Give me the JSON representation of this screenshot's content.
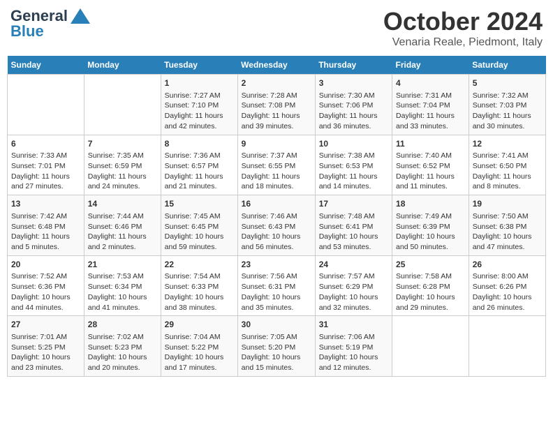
{
  "logo": {
    "line1": "General",
    "line2": "Blue"
  },
  "title": "October 2024",
  "subtitle": "Venaria Reale, Piedmont, Italy",
  "days_of_week": [
    "Sunday",
    "Monday",
    "Tuesday",
    "Wednesday",
    "Thursday",
    "Friday",
    "Saturday"
  ],
  "weeks": [
    [
      {
        "day": "",
        "data": ""
      },
      {
        "day": "",
        "data": ""
      },
      {
        "day": "1",
        "data": "Sunrise: 7:27 AM\nSunset: 7:10 PM\nDaylight: 11 hours and 42 minutes."
      },
      {
        "day": "2",
        "data": "Sunrise: 7:28 AM\nSunset: 7:08 PM\nDaylight: 11 hours and 39 minutes."
      },
      {
        "day": "3",
        "data": "Sunrise: 7:30 AM\nSunset: 7:06 PM\nDaylight: 11 hours and 36 minutes."
      },
      {
        "day": "4",
        "data": "Sunrise: 7:31 AM\nSunset: 7:04 PM\nDaylight: 11 hours and 33 minutes."
      },
      {
        "day": "5",
        "data": "Sunrise: 7:32 AM\nSunset: 7:03 PM\nDaylight: 11 hours and 30 minutes."
      }
    ],
    [
      {
        "day": "6",
        "data": "Sunrise: 7:33 AM\nSunset: 7:01 PM\nDaylight: 11 hours and 27 minutes."
      },
      {
        "day": "7",
        "data": "Sunrise: 7:35 AM\nSunset: 6:59 PM\nDaylight: 11 hours and 24 minutes."
      },
      {
        "day": "8",
        "data": "Sunrise: 7:36 AM\nSunset: 6:57 PM\nDaylight: 11 hours and 21 minutes."
      },
      {
        "day": "9",
        "data": "Sunrise: 7:37 AM\nSunset: 6:55 PM\nDaylight: 11 hours and 18 minutes."
      },
      {
        "day": "10",
        "data": "Sunrise: 7:38 AM\nSunset: 6:53 PM\nDaylight: 11 hours and 14 minutes."
      },
      {
        "day": "11",
        "data": "Sunrise: 7:40 AM\nSunset: 6:52 PM\nDaylight: 11 hours and 11 minutes."
      },
      {
        "day": "12",
        "data": "Sunrise: 7:41 AM\nSunset: 6:50 PM\nDaylight: 11 hours and 8 minutes."
      }
    ],
    [
      {
        "day": "13",
        "data": "Sunrise: 7:42 AM\nSunset: 6:48 PM\nDaylight: 11 hours and 5 minutes."
      },
      {
        "day": "14",
        "data": "Sunrise: 7:44 AM\nSunset: 6:46 PM\nDaylight: 11 hours and 2 minutes."
      },
      {
        "day": "15",
        "data": "Sunrise: 7:45 AM\nSunset: 6:45 PM\nDaylight: 10 hours and 59 minutes."
      },
      {
        "day": "16",
        "data": "Sunrise: 7:46 AM\nSunset: 6:43 PM\nDaylight: 10 hours and 56 minutes."
      },
      {
        "day": "17",
        "data": "Sunrise: 7:48 AM\nSunset: 6:41 PM\nDaylight: 10 hours and 53 minutes."
      },
      {
        "day": "18",
        "data": "Sunrise: 7:49 AM\nSunset: 6:39 PM\nDaylight: 10 hours and 50 minutes."
      },
      {
        "day": "19",
        "data": "Sunrise: 7:50 AM\nSunset: 6:38 PM\nDaylight: 10 hours and 47 minutes."
      }
    ],
    [
      {
        "day": "20",
        "data": "Sunrise: 7:52 AM\nSunset: 6:36 PM\nDaylight: 10 hours and 44 minutes."
      },
      {
        "day": "21",
        "data": "Sunrise: 7:53 AM\nSunset: 6:34 PM\nDaylight: 10 hours and 41 minutes."
      },
      {
        "day": "22",
        "data": "Sunrise: 7:54 AM\nSunset: 6:33 PM\nDaylight: 10 hours and 38 minutes."
      },
      {
        "day": "23",
        "data": "Sunrise: 7:56 AM\nSunset: 6:31 PM\nDaylight: 10 hours and 35 minutes."
      },
      {
        "day": "24",
        "data": "Sunrise: 7:57 AM\nSunset: 6:29 PM\nDaylight: 10 hours and 32 minutes."
      },
      {
        "day": "25",
        "data": "Sunrise: 7:58 AM\nSunset: 6:28 PM\nDaylight: 10 hours and 29 minutes."
      },
      {
        "day": "26",
        "data": "Sunrise: 8:00 AM\nSunset: 6:26 PM\nDaylight: 10 hours and 26 minutes."
      }
    ],
    [
      {
        "day": "27",
        "data": "Sunrise: 7:01 AM\nSunset: 5:25 PM\nDaylight: 10 hours and 23 minutes."
      },
      {
        "day": "28",
        "data": "Sunrise: 7:02 AM\nSunset: 5:23 PM\nDaylight: 10 hours and 20 minutes."
      },
      {
        "day": "29",
        "data": "Sunrise: 7:04 AM\nSunset: 5:22 PM\nDaylight: 10 hours and 17 minutes."
      },
      {
        "day": "30",
        "data": "Sunrise: 7:05 AM\nSunset: 5:20 PM\nDaylight: 10 hours and 15 minutes."
      },
      {
        "day": "31",
        "data": "Sunrise: 7:06 AM\nSunset: 5:19 PM\nDaylight: 10 hours and 12 minutes."
      },
      {
        "day": "",
        "data": ""
      },
      {
        "day": "",
        "data": ""
      }
    ]
  ]
}
